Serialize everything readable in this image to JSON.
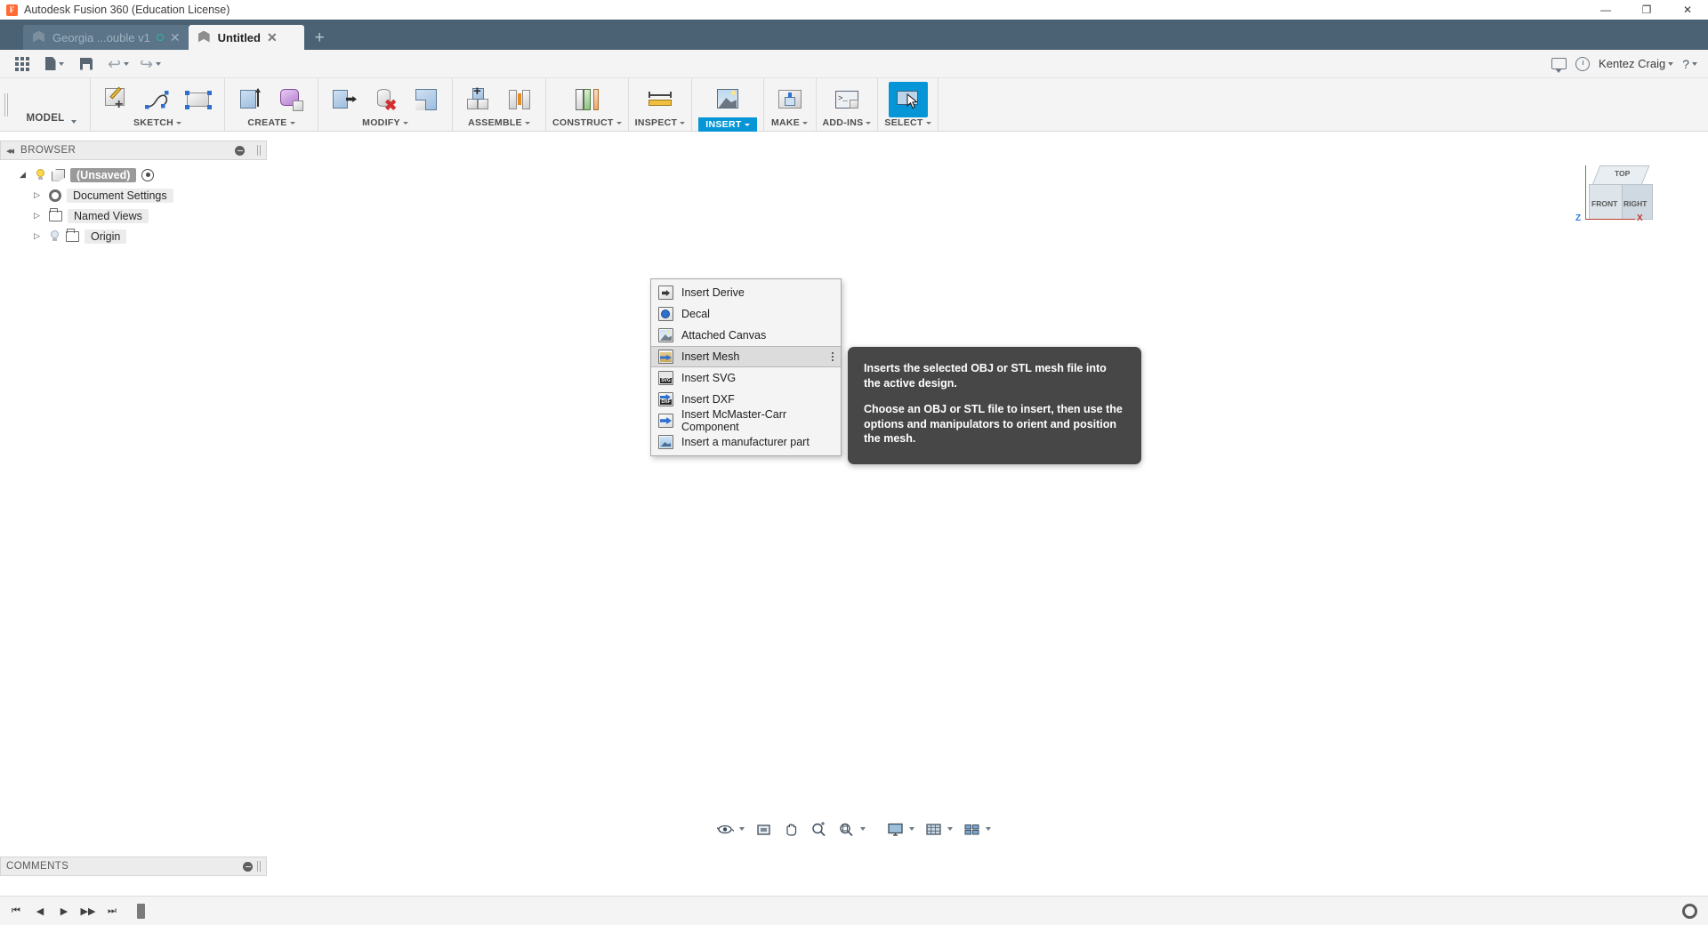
{
  "window": {
    "title": "Autodesk Fusion 360 (Education License)",
    "logo_text": "F",
    "minimize": "—",
    "maximize": "❐",
    "close": "✕"
  },
  "tabs": {
    "items": [
      {
        "label": "Georgia ...ouble v1",
        "active": false,
        "close": "✕",
        "has_status_dot": true
      },
      {
        "label": "Untitled",
        "active": true,
        "close": "✕",
        "has_status_dot": false
      }
    ],
    "new_tab": "+"
  },
  "quick_access": {
    "grid_name": "app-grid",
    "new_label": "New",
    "save_label": "Save",
    "undo_label": "Undo",
    "redo_label": "Redo",
    "user": "Kentez Craig",
    "user_caret": "▾",
    "help": "?",
    "help_caret": "▾"
  },
  "ribbon": {
    "workspace": {
      "label": "MODEL",
      "caret": "▾"
    },
    "panels": [
      {
        "label": "SKETCH",
        "caret": "▾",
        "open": false,
        "tools": [
          {
            "name": "create-sketch-icon",
            "title": "Create Sketch"
          },
          {
            "name": "spline-icon",
            "title": "Spline"
          },
          {
            "name": "rectangle-icon",
            "title": "Rectangle"
          }
        ]
      },
      {
        "label": "CREATE",
        "caret": "▾",
        "open": false,
        "tools": [
          {
            "name": "extrude-icon",
            "title": "Extrude"
          },
          {
            "name": "form-icon",
            "title": "Create Form"
          }
        ]
      },
      {
        "label": "MODIFY",
        "caret": "▾",
        "open": false,
        "tools": [
          {
            "name": "press-pull-icon",
            "title": "Press Pull"
          },
          {
            "name": "delete-icon",
            "title": "Delete"
          },
          {
            "name": "shell-icon",
            "title": "Shell"
          }
        ]
      },
      {
        "label": "ASSEMBLE",
        "caret": "▾",
        "open": false,
        "tools": [
          {
            "name": "new-component-icon",
            "title": "New Component"
          },
          {
            "name": "joint-icon",
            "title": "Joint"
          }
        ]
      },
      {
        "label": "CONSTRUCT",
        "caret": "▾",
        "open": false,
        "tools": [
          {
            "name": "offset-plane-icon",
            "title": "Offset Plane"
          }
        ]
      },
      {
        "label": "INSPECT",
        "caret": "▾",
        "open": false,
        "tools": [
          {
            "name": "measure-icon",
            "title": "Measure"
          }
        ]
      },
      {
        "label": "INSERT",
        "caret": "▾",
        "open": true,
        "tools": [
          {
            "name": "insert-canvas-icon",
            "title": "Insert"
          }
        ]
      },
      {
        "label": "MAKE",
        "caret": "▾",
        "open": false,
        "tools": [
          {
            "name": "3d-print-icon",
            "title": "3D Print"
          }
        ]
      },
      {
        "label": "ADD-INS",
        "caret": "▾",
        "open": false,
        "tools": [
          {
            "name": "scripts-addins-icon",
            "title": "Scripts and Add-Ins"
          }
        ]
      },
      {
        "label": "SELECT",
        "caret": "▾",
        "open": false,
        "tools": [
          {
            "name": "select-cursor-icon",
            "title": "Select"
          }
        ]
      }
    ]
  },
  "viewcube": {
    "top": "TOP",
    "front": "FRONT",
    "right": "RIGHT",
    "axis_z": "Z",
    "axis_x": "X"
  },
  "browser": {
    "title": "BROWSER",
    "collapse_icon": "◂◂",
    "nodes": [
      {
        "label": "(Unsaved)",
        "indent": 0,
        "selected": true,
        "arrow": "◢",
        "bulb": "on",
        "icon": "cube",
        "has_eye": true
      },
      {
        "label": "Document Settings",
        "indent": 1,
        "selected": false,
        "arrow": "▷",
        "bulb": "none",
        "icon": "gear",
        "has_eye": false
      },
      {
        "label": "Named Views",
        "indent": 1,
        "selected": false,
        "arrow": "▷",
        "bulb": "none",
        "icon": "folder",
        "has_eye": false
      },
      {
        "label": "Origin",
        "indent": 1,
        "selected": false,
        "arrow": "▷",
        "bulb": "off",
        "icon": "folder",
        "has_eye": false
      }
    ]
  },
  "insert_menu": {
    "items": [
      {
        "label": "Insert Derive",
        "icon": "insert-derive-icon",
        "active": false,
        "overflow": false
      },
      {
        "label": "Decal",
        "icon": "decal-icon",
        "active": false,
        "overflow": false
      },
      {
        "label": "Attached Canvas",
        "icon": "attached-canvas-icon",
        "active": false,
        "overflow": false
      },
      {
        "label": "Insert Mesh",
        "icon": "insert-mesh-icon",
        "active": true,
        "overflow": true
      },
      {
        "label": "Insert SVG",
        "icon": "insert-svg-icon",
        "active": false,
        "overflow": false
      },
      {
        "label": "Insert DXF",
        "icon": "insert-dxf-icon",
        "active": false,
        "overflow": false
      },
      {
        "label": "Insert McMaster-Carr Component",
        "icon": "insert-mcmaster-icon",
        "active": false,
        "overflow": false
      },
      {
        "label": "Insert a manufacturer part",
        "icon": "insert-manufacturer-part-icon",
        "active": false,
        "overflow": false
      }
    ]
  },
  "tooltip": {
    "paragraphs": [
      "Inserts the selected OBJ or STL mesh file into the active design.",
      "Choose an OBJ or STL file to insert, then use the options and manipulators to orient and position the mesh."
    ]
  },
  "comments": {
    "title": "COMMENTS"
  },
  "navbar": {
    "buttons": [
      {
        "name": "orbit-button",
        "label": "Orbit",
        "caret": "▾"
      },
      {
        "name": "look-at-button",
        "label": "Look At",
        "caret": ""
      },
      {
        "name": "pan-button",
        "label": "Pan",
        "caret": ""
      },
      {
        "name": "zoom-button",
        "label": "Zoom",
        "caret": ""
      },
      {
        "name": "fit-button",
        "label": "Fit",
        "caret": "▾"
      },
      {
        "name": "display-settings-button",
        "label": "Display Settings",
        "caret": "▾"
      },
      {
        "name": "grid-snaps-button",
        "label": "Grid and Snaps",
        "caret": "▾"
      },
      {
        "name": "viewports-button",
        "label": "Viewports",
        "caret": "▾"
      }
    ]
  },
  "timeline": {
    "buttons": [
      {
        "name": "timeline-begin-button",
        "glyph": "⏮"
      },
      {
        "name": "timeline-prev-button",
        "glyph": "◀"
      },
      {
        "name": "timeline-play-button",
        "glyph": "▶"
      },
      {
        "name": "timeline-next-button",
        "glyph": "▶▶"
      },
      {
        "name": "timeline-end-button",
        "glyph": "⏭"
      }
    ],
    "settings_label": "Settings"
  },
  "colors": {
    "accent": "#0696d7",
    "tabstrip": "#4a6274",
    "ribbon_bg": "#f4f4f4",
    "tooltip_bg": "#474747",
    "selection_gray": "#9a9a9a"
  }
}
